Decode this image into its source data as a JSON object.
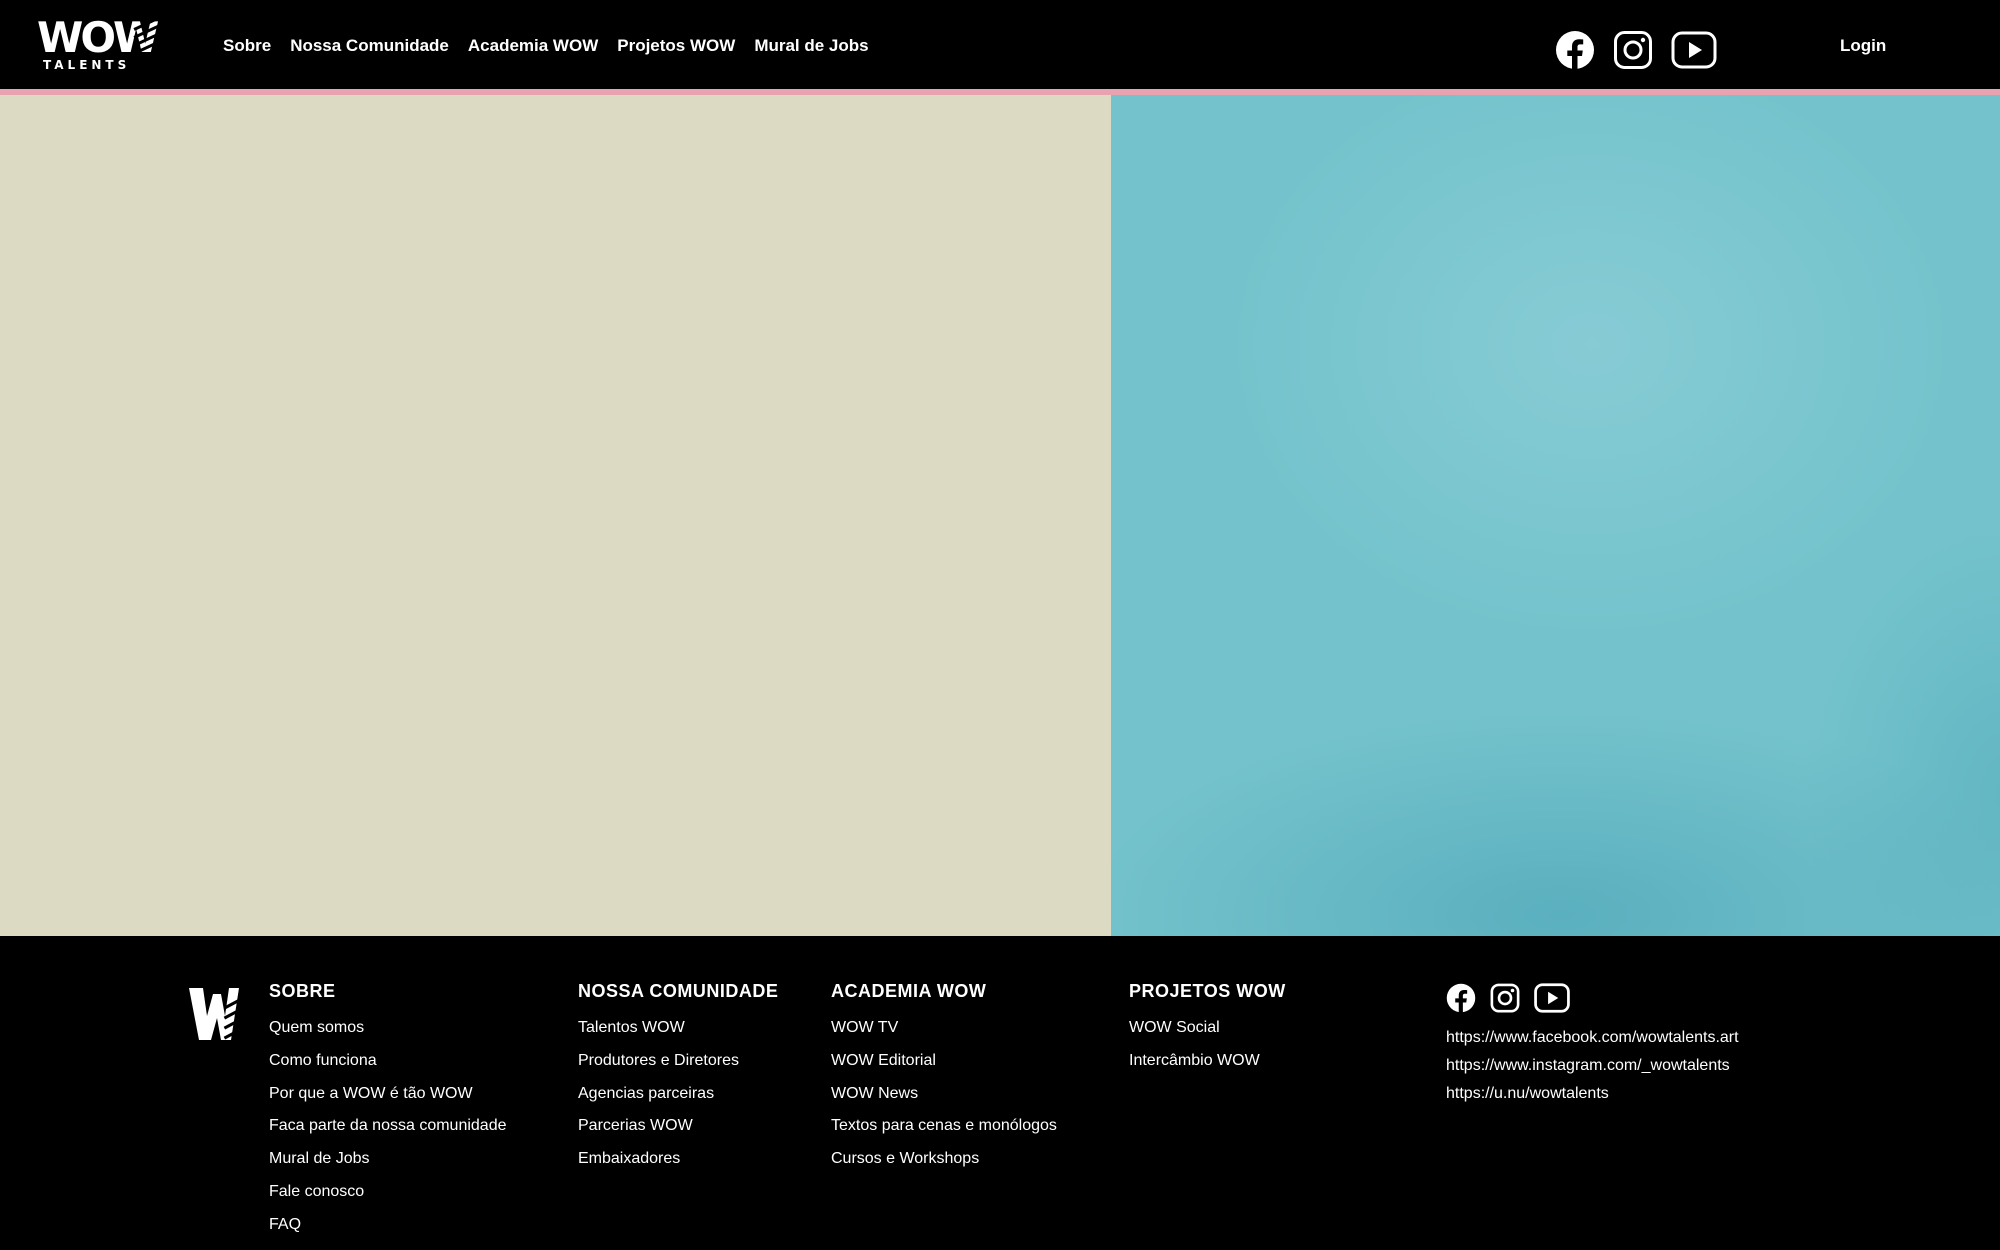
{
  "brand": {
    "logo_top": "WOW",
    "logo_bottom": "TALENTS",
    "accent_color": "#e8a3b1"
  },
  "nav": {
    "items": [
      {
        "label": "Sobre"
      },
      {
        "label": "Nossa Comunidade"
      },
      {
        "label": "Academia WOW"
      },
      {
        "label": "Projetos WOW"
      },
      {
        "label": "Mural de Jobs"
      }
    ],
    "social_icons": [
      "facebook-icon",
      "instagram-icon",
      "youtube-icon"
    ],
    "login_label": "Login"
  },
  "hero": {
    "left_color": "#dcdac3",
    "right_color": "#74c3cc"
  },
  "footer": {
    "columns": [
      {
        "title": "SOBRE",
        "links": [
          "Quem somos",
          "Como funciona",
          "Por que a WOW é tão WOW",
          "Faca parte da nossa comunidade",
          "Mural de Jobs",
          "Fale conosco",
          "FAQ"
        ]
      },
      {
        "title": "NOSSA COMUNIDADE",
        "links": [
          "Talentos WOW",
          "Produtores e Diretores",
          "Agencias parceiras",
          "Parcerias WOW",
          "Embaixadores"
        ]
      },
      {
        "title": "ACADEMIA WOW",
        "links": [
          "WOW TV",
          "WOW Editorial",
          "WOW News",
          "Textos para cenas e monólogos",
          "Cursos e Workshops"
        ]
      },
      {
        "title": "PROJETOS WOW",
        "links": [
          "WOW Social",
          "Intercâmbio WOW"
        ]
      }
    ],
    "social_links": [
      "https://www.facebook.com/wowtalents.art",
      "https://www.instagram.com/_wowtalents",
      "https://u.nu/wowtalents"
    ]
  }
}
